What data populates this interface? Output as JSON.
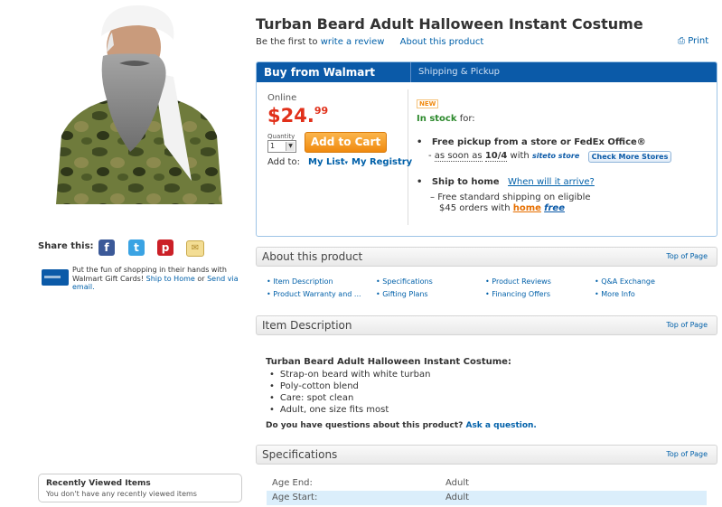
{
  "product": {
    "title": "Turban Beard Adult Halloween Instant Costume",
    "review_prefix": "Be the first to",
    "review_link": "write a review",
    "about_link": "About this product",
    "print": "Print"
  },
  "share": {
    "label": "Share this:",
    "gift_text_1": "Put the fun of shopping in their hands with Walmart Gift Cards!",
    "ship_home_link": "Ship to Home",
    "or_text": "or",
    "send_email_link": "Send via email."
  },
  "buy": {
    "title": "Buy from Walmart",
    "shipping_tab": "Shipping & Pickup",
    "online": "Online",
    "price_dollars": "$24.",
    "price_cents": "99",
    "qty_label": "Quantity",
    "qty_value": "1",
    "add_to_cart": "Add to Cart",
    "add_to": "Add to:",
    "my_list": "My List",
    "my_registry": "My Registry",
    "new_badge": "NEW",
    "in_stock": "In stock",
    "in_stock_for": "for:",
    "pickup_title": "Free pickup from a store or FedEx Office®",
    "pickup_asap": "as soon as",
    "pickup_date": "10/4",
    "pickup_with": "with",
    "site_to_store": "siteto store",
    "check_stores": "Check More Stores",
    "ship_title": "Ship to home",
    "ship_when": "When will it arrive?",
    "ship_line1": "Free standard shipping on eligible",
    "ship_line2": "$45 orders with",
    "home": "home",
    "free": "free"
  },
  "about": {
    "title": "About this product",
    "top": "Top of Page",
    "links": [
      "Item Description",
      "Specifications",
      "Product Reviews",
      "Q&A Exchange",
      "Product Warranty and ...",
      "Gifting Plans",
      "Financing Offers",
      "More Info"
    ]
  },
  "item_description": {
    "title": "Item Description",
    "top": "Top of Page",
    "heading": "Turban Beard Adult Halloween Instant Costume:",
    "bullets": [
      "Strap-on beard with white turban",
      "Poly-cotton blend",
      "Care: spot clean",
      "Adult, one size fits most"
    ],
    "question": "Do you have questions about this product?",
    "ask": "Ask a question."
  },
  "specifications": {
    "title": "Specifications",
    "top": "Top of Page",
    "rows": [
      {
        "key": "Age End:",
        "value": "Adult"
      },
      {
        "key": "Age Start:",
        "value": "Adult"
      }
    ]
  },
  "recent": {
    "title": "Recently Viewed Items",
    "subtitle": "You don't have any recently viewed items"
  },
  "colors": {
    "walmart_blue": "#0b5aa8",
    "price_red": "#e1301a",
    "cart_orange": "#f08a0f",
    "link_blue": "#0060a9"
  }
}
